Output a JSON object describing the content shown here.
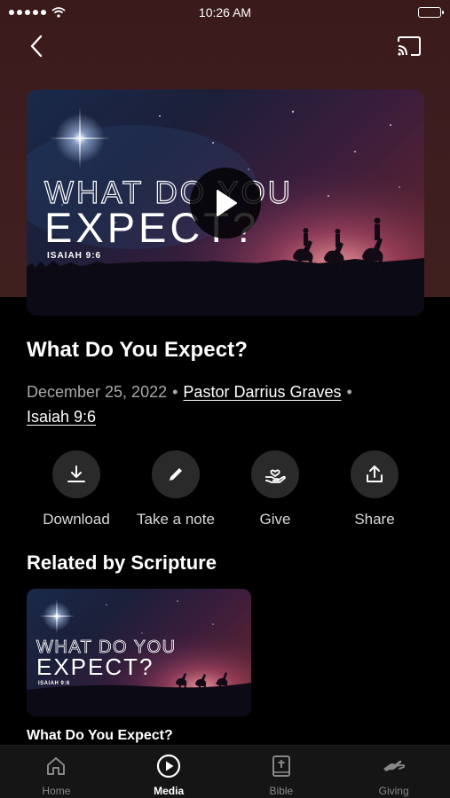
{
  "status_bar": {
    "time": "10:26 AM"
  },
  "video": {
    "artwork_line1": "WHAT DO YOU",
    "artwork_line2": "EXPECT?",
    "artwork_reference": "ISAIAH 9:6"
  },
  "sermon": {
    "title": "What Do You Expect?",
    "date": "December 25, 2022",
    "speaker": "Pastor Darrius Graves",
    "scripture": "Isaiah 9:6"
  },
  "actions": [
    {
      "label": "Download",
      "icon": "download-icon"
    },
    {
      "label": "Take a note",
      "icon": "pencil-icon"
    },
    {
      "label": "Give",
      "icon": "giving-hand-icon"
    },
    {
      "label": "Share",
      "icon": "share-icon"
    }
  ],
  "related": {
    "heading": "Related by Scripture",
    "items": [
      {
        "title": "What Do You Expect?",
        "artwork_line1": "WHAT DO YOU",
        "artwork_line2": "EXPECT?",
        "artwork_reference": "ISAIAH 9:6"
      }
    ]
  },
  "tabs": [
    {
      "label": "Home",
      "icon": "home-icon",
      "active": false
    },
    {
      "label": "Media",
      "icon": "play-circle-icon",
      "active": true
    },
    {
      "label": "Bible",
      "icon": "bible-icon",
      "active": false
    },
    {
      "label": "Giving",
      "icon": "giving-hand-icon",
      "active": false
    }
  ],
  "colors": {
    "background": "#000000",
    "hero": "#3d1d1f",
    "tab_bar": "#151515",
    "muted_text": "#a8a8a8"
  }
}
